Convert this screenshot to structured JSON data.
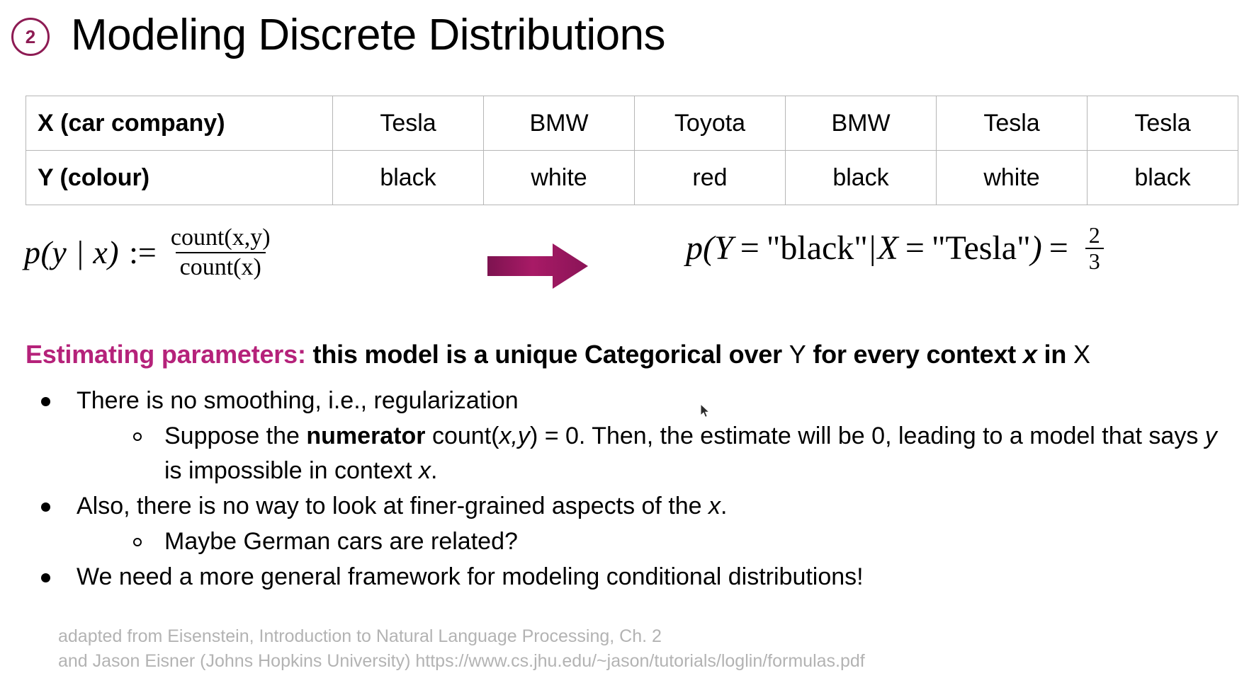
{
  "slide": {
    "number_badge": "2",
    "title": "Modeling Discrete Distributions",
    "accent_color": "#8d1b53",
    "accent_text_color": "#b5227a",
    "arrow_color": "#9c1a5e",
    "background_color": "#ffffff"
  },
  "table": {
    "rows": [
      {
        "label": "X (car company)",
        "cells": [
          "Tesla",
          "BMW",
          "Toyota",
          "BMW",
          "Tesla",
          "Tesla"
        ]
      },
      {
        "label": "Y (colour)",
        "cells": [
          "black",
          "white",
          "red",
          "black",
          "white",
          "black"
        ]
      }
    ]
  },
  "formula": {
    "left": {
      "lhs": "p(y | x)",
      "assign": ":=",
      "numerator": "count(x,y)",
      "denominator": "count(x)"
    },
    "arrow_icon": "right-block-arrow-icon",
    "right": {
      "p": "p(",
      "var_y": "Y",
      "eq1": "=",
      "value_y": "\"black\"",
      "bar": "|",
      "var_x": "X",
      "eq2": "=",
      "value_x": "\"Tesla\"",
      "close": ")",
      "eq3": "=",
      "result_numerator": "2",
      "result_denominator": "3"
    }
  },
  "estimating": {
    "label": "Estimating parameters:",
    "part1": "this model is a unique Categorical over",
    "var_y": "Y",
    "part2": "for every context",
    "var_x_italic": "x",
    "part3": "in",
    "var_x": "X"
  },
  "bullets": [
    {
      "level": 1,
      "marker": "filled-bullet-icon",
      "segments": [
        {
          "text": "There is no smoothing, i.e., regularization",
          "style": "normal"
        }
      ]
    },
    {
      "level": 2,
      "marker": "hollow-bullet-icon",
      "segments": [
        {
          "text": "Suppose the ",
          "style": "normal"
        },
        {
          "text": "numerator",
          "style": "bold"
        },
        {
          "text": " count(",
          "style": "normal"
        },
        {
          "text": "x,y",
          "style": "italic"
        },
        {
          "text": ") = 0. Then, the estimate will be 0, leading to a model that says ",
          "style": "normal"
        },
        {
          "text": "y",
          "style": "italic"
        },
        {
          "text": " is impossible in context ",
          "style": "normal"
        },
        {
          "text": "x",
          "style": "italic"
        },
        {
          "text": ".",
          "style": "normal"
        }
      ]
    },
    {
      "level": 1,
      "marker": "filled-bullet-icon",
      "segments": [
        {
          "text": "Also, there is no way to look at finer-grained aspects of the ",
          "style": "normal"
        },
        {
          "text": "x",
          "style": "italic"
        },
        {
          "text": ".",
          "style": "normal"
        }
      ]
    },
    {
      "level": 2,
      "marker": "hollow-bullet-icon",
      "segments": [
        {
          "text": "Maybe German cars are related?",
          "style": "normal"
        }
      ]
    },
    {
      "level": 1,
      "marker": "filled-bullet-icon",
      "segments": [
        {
          "text": "We need a more general framework for modeling conditional distributions!",
          "style": "normal"
        }
      ]
    }
  ],
  "footer": {
    "line1": "adapted from Eisenstein, Introduction to Natural Language Processing, Ch. 2",
    "line2": "and Jason Eisner (Johns Hopkins University) https://www.cs.jhu.edu/~jason/tutorials/loglin/formulas.pdf"
  }
}
